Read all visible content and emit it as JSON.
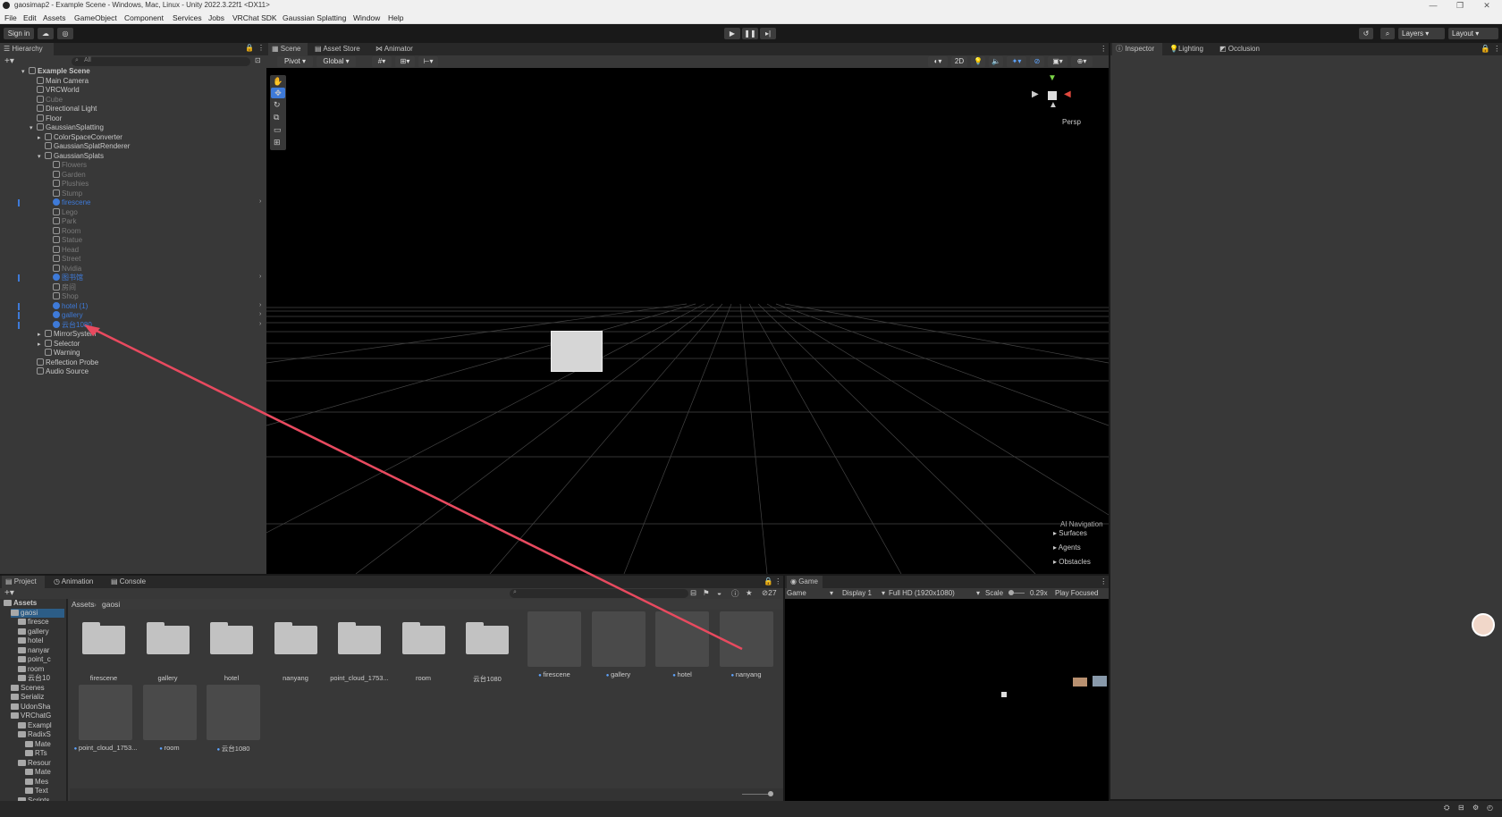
{
  "window": {
    "title": "gaosimap2 - Example Scene - Windows, Mac, Linux - Unity 2022.3.22f1 <DX11>"
  },
  "menu": [
    "File",
    "Edit",
    "Assets",
    "GameObject",
    "Component",
    "Services",
    "Jobs",
    "VRChat SDK",
    "Gaussian Splatting",
    "Window",
    "Help"
  ],
  "toolbar": {
    "sign_in": "Sign in",
    "layers": "Layers",
    "layout": "Layout"
  },
  "hierarchy": {
    "tab": "Hierarchy",
    "search_placeholder": "All",
    "rows": [
      {
        "label": "Example Scene",
        "indent": 0,
        "style": "scene"
      },
      {
        "label": "Main Camera",
        "indent": 1,
        "style": "normal"
      },
      {
        "label": "VRCWorld",
        "indent": 1,
        "style": "normal"
      },
      {
        "label": "Cube",
        "indent": 1,
        "style": "dim"
      },
      {
        "label": "Directional Light",
        "indent": 1,
        "style": "normal"
      },
      {
        "label": "Floor",
        "indent": 1,
        "style": "normal"
      },
      {
        "label": "GaussianSplatting",
        "indent": 1,
        "style": "normal"
      },
      {
        "label": "ColorSpaceConverter",
        "indent": 2,
        "style": "normal"
      },
      {
        "label": "GaussianSplatRenderer",
        "indent": 2,
        "style": "normal"
      },
      {
        "label": "GaussianSplats",
        "indent": 2,
        "style": "normal"
      },
      {
        "label": "Flowers",
        "indent": 3,
        "style": "dim"
      },
      {
        "label": "Garden",
        "indent": 3,
        "style": "dim"
      },
      {
        "label": "Plushies",
        "indent": 3,
        "style": "dim"
      },
      {
        "label": "Stump",
        "indent": 3,
        "style": "dim"
      },
      {
        "label": "firescene",
        "indent": 3,
        "style": "blue"
      },
      {
        "label": "Lego",
        "indent": 3,
        "style": "dim"
      },
      {
        "label": "Park",
        "indent": 3,
        "style": "dim"
      },
      {
        "label": "Room",
        "indent": 3,
        "style": "dim"
      },
      {
        "label": "Statue",
        "indent": 3,
        "style": "dim"
      },
      {
        "label": "Head",
        "indent": 3,
        "style": "dim"
      },
      {
        "label": "Street",
        "indent": 3,
        "style": "dim"
      },
      {
        "label": "Nvidia",
        "indent": 3,
        "style": "dim"
      },
      {
        "label": "图书馆",
        "indent": 3,
        "style": "blue"
      },
      {
        "label": "房间",
        "indent": 3,
        "style": "dim"
      },
      {
        "label": "Shop",
        "indent": 3,
        "style": "dim"
      },
      {
        "label": "hotel (1)",
        "indent": 3,
        "style": "blue"
      },
      {
        "label": "gallery",
        "indent": 3,
        "style": "blue"
      },
      {
        "label": "云台1080",
        "indent": 3,
        "style": "blue"
      },
      {
        "label": "MirrorSystem",
        "indent": 2,
        "style": "normal"
      },
      {
        "label": "Selector",
        "indent": 2,
        "style": "normal"
      },
      {
        "label": "Warning",
        "indent": 2,
        "style": "normal"
      },
      {
        "label": "Reflection Probe",
        "indent": 1,
        "style": "normal"
      },
      {
        "label": "Audio Source",
        "indent": 1,
        "style": "normal"
      }
    ]
  },
  "scene": {
    "tabs": [
      "Scene",
      "Asset Store",
      "Animator"
    ],
    "pivot": "Pivot",
    "global": "Global",
    "mode_2d": "2D",
    "persp": "Persp",
    "ai_nav": {
      "title": "AI Navigation",
      "items": [
        "Surfaces",
        "Agents",
        "Obstacles"
      ]
    }
  },
  "inspector": {
    "tabs": [
      "Inspector",
      "Lighting",
      "Occlusion"
    ]
  },
  "project": {
    "tabs": [
      "Project",
      "Animation",
      "Console"
    ],
    "breadcrumb": [
      "Assets",
      "gaosi"
    ],
    "hidden_count": "27",
    "tree": [
      {
        "label": "Assets",
        "indent": 0
      },
      {
        "label": "gaosi",
        "indent": 1
      },
      {
        "label": "firesce",
        "indent": 2
      },
      {
        "label": "gallery",
        "indent": 2
      },
      {
        "label": "hotel",
        "indent": 2
      },
      {
        "label": "nanyar",
        "indent": 2
      },
      {
        "label": "point_c",
        "indent": 2
      },
      {
        "label": "room",
        "indent": 2
      },
      {
        "label": "云台10",
        "indent": 2
      },
      {
        "label": "Scenes",
        "indent": 1
      },
      {
        "label": "Serializ",
        "indent": 1
      },
      {
        "label": "UdonSha",
        "indent": 1
      },
      {
        "label": "VRChatG",
        "indent": 1
      },
      {
        "label": "Exampl",
        "indent": 2
      },
      {
        "label": "RadixS",
        "indent": 2
      },
      {
        "label": "Mate",
        "indent": 3
      },
      {
        "label": "RTs",
        "indent": 3
      },
      {
        "label": "Resour",
        "indent": 2
      },
      {
        "label": "Mate",
        "indent": 3
      },
      {
        "label": "Mes",
        "indent": 3
      },
      {
        "label": "Text",
        "indent": 3
      },
      {
        "label": "Scripts",
        "indent": 2
      }
    ],
    "folders": [
      "firescene",
      "gallery",
      "hotel",
      "nanyang",
      "point_cloud_1753...",
      "room",
      "云台1080"
    ],
    "prefabs_row1": [
      "firescene",
      "gallery",
      "hotel",
      "nanyang"
    ],
    "prefabs_row2": [
      "point_cloud_1753...",
      "room",
      "云台1080"
    ]
  },
  "game": {
    "tab": "Game",
    "view": "Game",
    "display": "Display 1",
    "resolution": "Full HD (1920x1080)",
    "scale_label": "Scale",
    "scale_value": "0.29x",
    "play_focused": "Play Focused"
  },
  "colors": {
    "accent": "#3e7ad8",
    "annotation": "#e84a5f"
  }
}
